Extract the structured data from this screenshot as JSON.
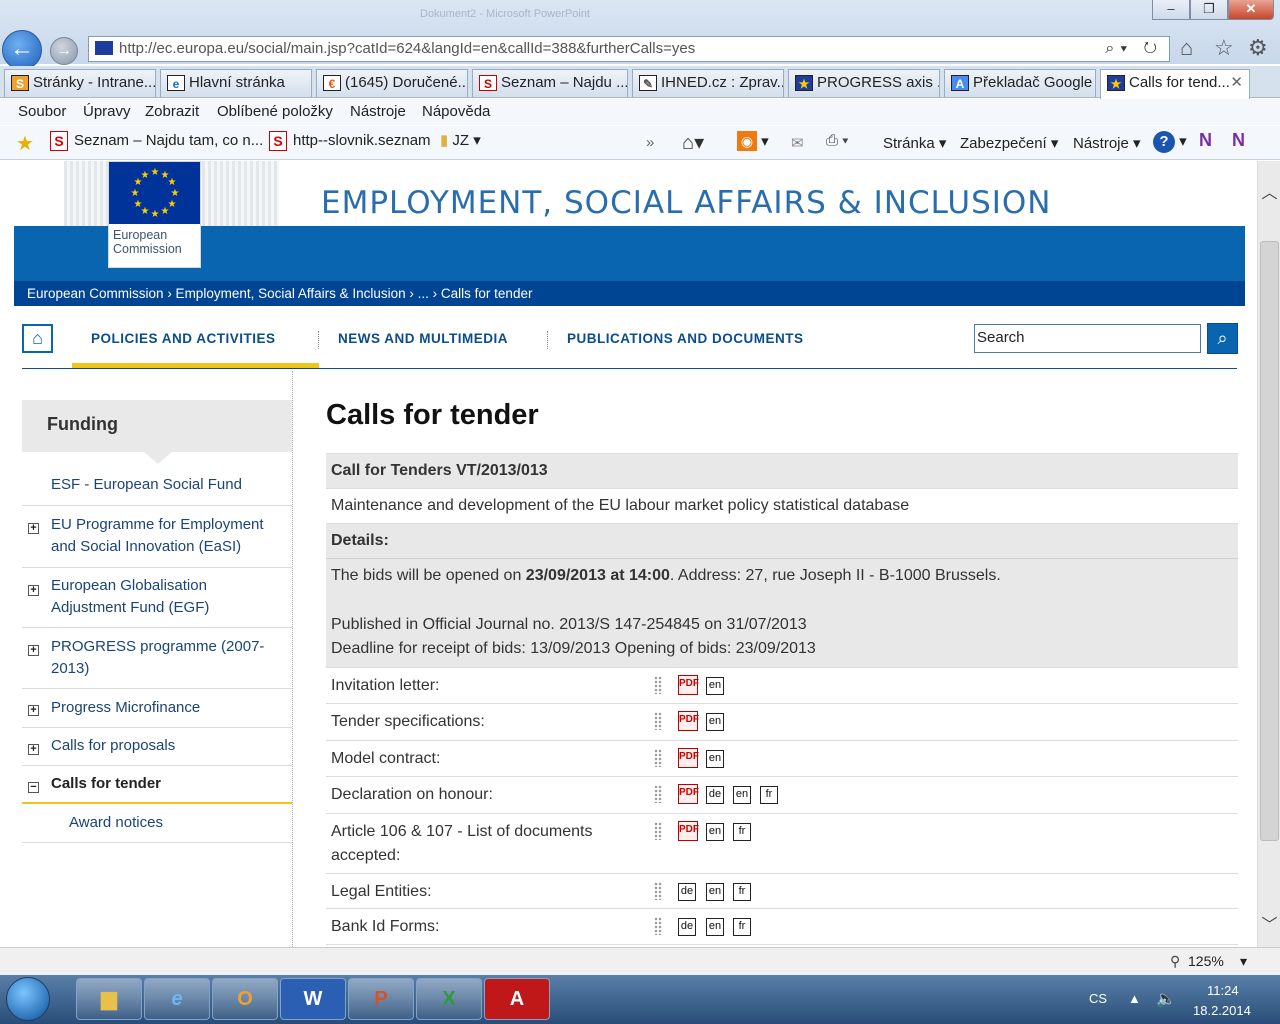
{
  "browser": {
    "ghost_title": "Dokument2 - Microsoft PowerPoint",
    "address": "http://ec.europa.eu/social/main.jsp?catId=624&langId=en&callId=388&furtherCalls=yes",
    "tabs": [
      {
        "label": "Stránky - Intrane..."
      },
      {
        "label": "Hlavní stránka"
      },
      {
        "label": "(1645) Doručené..."
      },
      {
        "label": "Seznam – Najdu ..."
      },
      {
        "label": "IHNED.cz : Zprav..."
      },
      {
        "label": "PROGRESS axis ..."
      },
      {
        "label": "Překladač Google"
      },
      {
        "label": "Calls for tend..."
      }
    ],
    "menu": [
      "Soubor",
      "Úpravy",
      "Zobrazit",
      "Oblíbené položky",
      "Nástroje",
      "Nápověda"
    ],
    "favorites": [
      {
        "label": "Seznam – Najdu tam, co n..."
      },
      {
        "label": "http--slovnik.seznam"
      },
      {
        "label": "JZ"
      }
    ],
    "command_items": [
      "Stránka",
      "Zabezpečení",
      "Nástroje"
    ],
    "zoom": "125%"
  },
  "site": {
    "logo_text_1": "European",
    "logo_text_2": "Commission",
    "title": "EMPLOYMENT, SOCIAL AFFAIRS & INCLUSION",
    "breadcrumb": "European Commission › Employment, Social Affairs & Inclusion › ... › Calls for tender",
    "nav": [
      "POLICIES AND ACTIVITIES",
      "NEWS AND MULTIMEDIA",
      "PUBLICATIONS AND DOCUMENTS"
    ],
    "search_placeholder": "Search"
  },
  "sidebar": {
    "heading": "Funding",
    "items": [
      {
        "label": "ESF - European Social Fund"
      },
      {
        "label": "EU Programme for Employment and Social Innovation (EaSI)"
      },
      {
        "label": "European Globalisation Adjustment Fund (EGF)"
      },
      {
        "label": "PROGRESS programme (2007-2013)"
      },
      {
        "label": "Progress Microfinance"
      },
      {
        "label": "Calls for proposals"
      },
      {
        "label": "Calls for tender"
      },
      {
        "label": "Award notices"
      }
    ]
  },
  "main": {
    "heading": "Calls for tender",
    "call_title": "Call for Tenders VT/2013/013",
    "description": "Maintenance and development of the EU labour market policy statistical database",
    "details_label": "Details:",
    "bids_prefix": "The bids will be opened on ",
    "bids_date": "23/09/2013 at 14:00",
    "bids_suffix": ". Address: 27, rue Joseph II - B-1000 Brussels.",
    "published": "Published in Official Journal no. 2013/S 147-254845 on 31/07/2013",
    "deadline": "Deadline for receipt of bids: 13/09/2013 Opening of bids: 23/09/2013",
    "documents": [
      {
        "label": "Invitation letter:",
        "pdf": true,
        "langs": [
          "en"
        ]
      },
      {
        "label": "Tender specifications:",
        "pdf": true,
        "langs": [
          "en"
        ]
      },
      {
        "label": "Model contract:",
        "pdf": true,
        "langs": [
          "en"
        ]
      },
      {
        "label": "Declaration on honour:",
        "pdf": true,
        "langs": [
          "de",
          "en",
          "fr"
        ]
      },
      {
        "label": "Article 106 & 107 - List of documents accepted:",
        "pdf": true,
        "langs": [
          "en",
          "fr"
        ]
      },
      {
        "label": "Legal Entities:",
        "pdf": false,
        "langs": [
          "de",
          "en",
          "fr"
        ]
      },
      {
        "label": "Bank Id Forms:",
        "pdf": false,
        "langs": [
          "de",
          "en",
          "fr"
        ]
      }
    ]
  },
  "taskbar": {
    "lang": "CS",
    "time": "11:24",
    "date": "18.2.2014"
  }
}
